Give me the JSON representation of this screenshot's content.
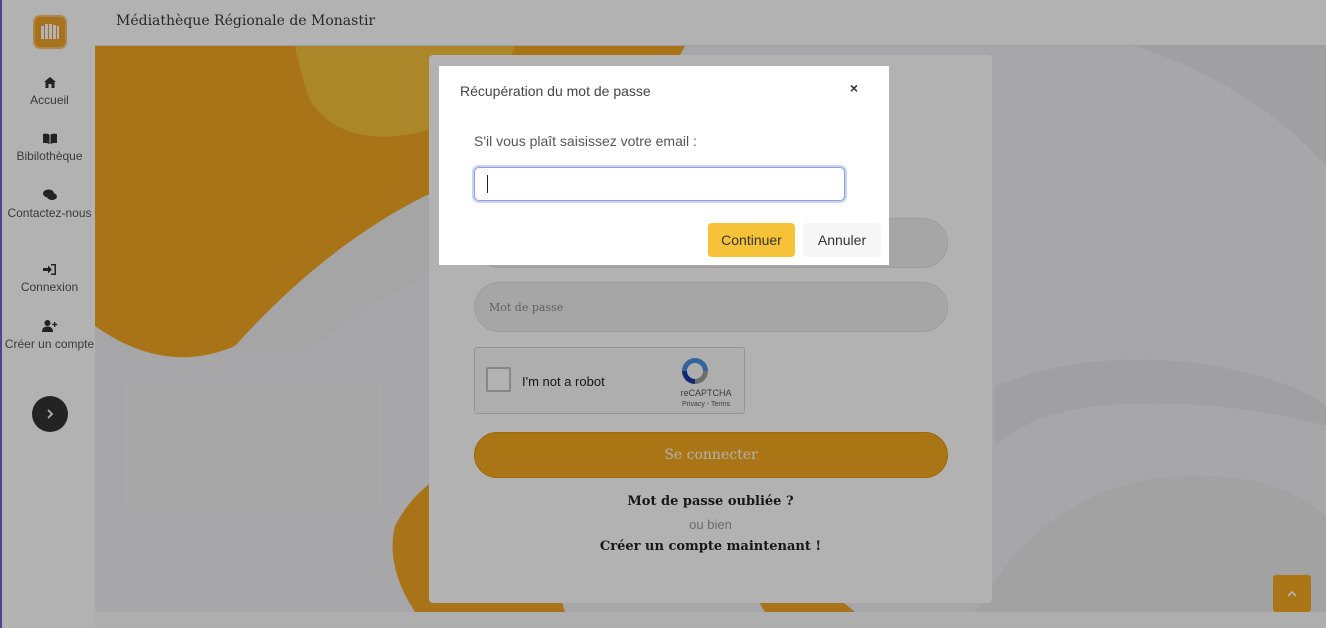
{
  "header": {
    "site_title": "Médiathèque Régionale de Monastir"
  },
  "sidebar": {
    "items": [
      {
        "label": "Accueil",
        "icon": "home-icon"
      },
      {
        "label": "Bibilothèque",
        "icon": "book-icon"
      },
      {
        "label": "Contactez-nous",
        "icon": "chat-icon"
      },
      {
        "label": "Connexion",
        "icon": "sign-in-icon"
      },
      {
        "label": "Créer un compte",
        "icon": "user-plus-icon"
      }
    ],
    "toggle_icon": "chevron-right-icon"
  },
  "login_form": {
    "password_placeholder": "Mot de passe",
    "captcha": {
      "label": "I'm not a robot",
      "brand": "reCAPTCHA",
      "links": "Privacy - Terms"
    },
    "submit_label": "Se connecter",
    "forgot_label": "Mot de passe oubliée ?",
    "or_label": "ou bien",
    "create_account_label": "Créer un compte maintenant !"
  },
  "modal": {
    "title": "Récupération du mot de passe",
    "close_label": "×",
    "prompt": "S'il vous plaît saisissez votre email :",
    "email_value": "",
    "continue_label": "Continuer",
    "cancel_label": "Annuler"
  },
  "colors": {
    "accent": "#f4a81d",
    "continue_button": "#f6c237",
    "sidebar_text": "#555555"
  }
}
